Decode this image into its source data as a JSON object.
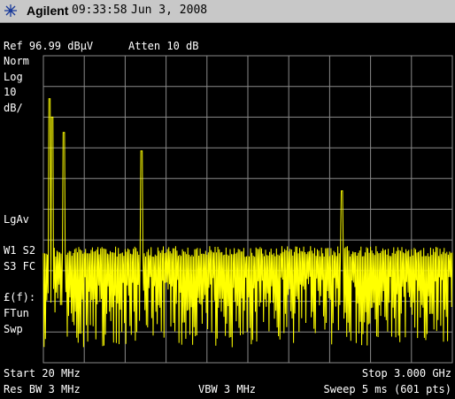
{
  "header": {
    "brand": "Agilent",
    "time": "09:33:58",
    "date": "Jun 3, 2008",
    "logo_icon": "agilent-spark-icon"
  },
  "readout": {
    "ref": "Ref 96.99 dBµV",
    "atten": "Atten 10 dB",
    "norm": "Norm",
    "log": "Log",
    "scale_value": "10",
    "scale_unit": "dB/",
    "lgav": "LgAv",
    "w1s2": "W1  S2",
    "s3fc": "S3  FC",
    "ff": "£(f):",
    "ftun": "FTun",
    "swp": "Swp"
  },
  "footer": {
    "start": "Start 20 MHz",
    "stop": "Stop 3.000 GHz",
    "res_bw": "Res BW 3 MHz",
    "vbw": "VBW 3 MHz",
    "sweep": "Sweep 5 ms (601 pts)"
  },
  "colors": {
    "trace": "#ffff00",
    "grid": "#8a8a8a",
    "background": "#000000",
    "titlebar": "#c8c8c8"
  },
  "trace": {
    "points": 601,
    "noise_floor_div": 6.2,
    "peaks": [
      {
        "freq_frac": 0.015,
        "level_div": 1.4
      },
      {
        "freq_frac": 0.022,
        "level_div": 2.0
      },
      {
        "freq_frac": 0.05,
        "level_div": 2.5
      },
      {
        "freq_frac": 0.24,
        "level_div": 3.1
      },
      {
        "freq_frac": 0.73,
        "level_div": 4.4
      }
    ]
  }
}
